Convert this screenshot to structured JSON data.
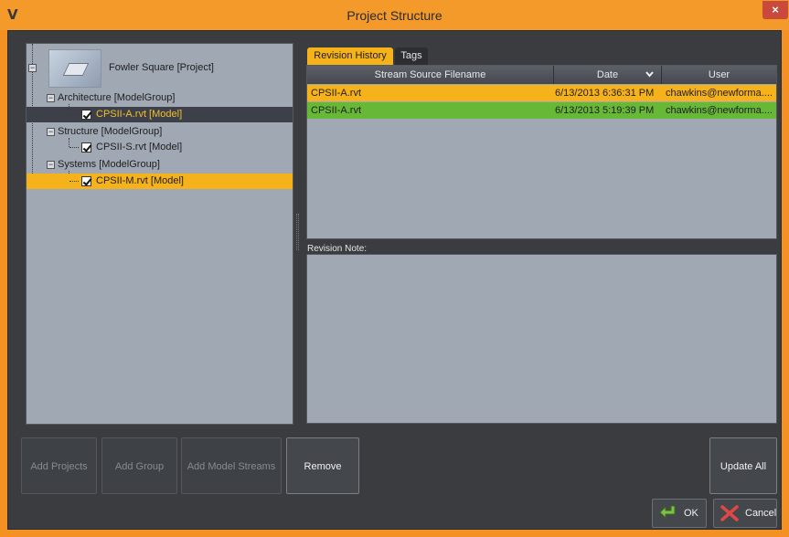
{
  "window": {
    "title": "Project Structure",
    "close_label": "×",
    "app_icon": "V"
  },
  "tree": {
    "project": "Fowler Square [Project]",
    "groups": [
      {
        "label": "Architecture [ModelGroup]",
        "models": [
          "CPSII-A.rvt [Model]"
        ]
      },
      {
        "label": "Structure [ModelGroup]",
        "models": [
          "CPSII-S.rvt [Model]"
        ]
      },
      {
        "label": "Systems [ModelGroup]",
        "models": [
          "CPSII-M.rvt [Model]"
        ]
      }
    ]
  },
  "tabs": [
    {
      "label": "Revision History"
    },
    {
      "label": "Tags"
    }
  ],
  "grid": {
    "columns": [
      "Stream Source Filename",
      "Date",
      "User"
    ],
    "sort_icon": "chevron-down-icon",
    "rows": [
      {
        "filename": "CPSII-A.rvt",
        "date": "6/13/2013 6:36:31 PM",
        "user": "chawkins@newforma....",
        "color": "#f6b21a"
      },
      {
        "filename": "CPSII-A.rvt",
        "date": "6/13/2013 5:19:39 PM",
        "user": "chawkins@newforma....",
        "color": "#68b838"
      }
    ]
  },
  "revision_note": {
    "label": "Revision Note:",
    "value": ""
  },
  "buttons": {
    "add_projects": "Add Projects",
    "add_group": "Add Group",
    "add_model_streams": "Add Model Streams",
    "remove": "Remove",
    "update_all": "Update All",
    "ok": "OK",
    "cancel": "Cancel"
  },
  "colors": {
    "accent_orange": "#f6b21a",
    "accent_green": "#68b838",
    "panel": "#a0a8b4",
    "background": "#3a3c40"
  }
}
